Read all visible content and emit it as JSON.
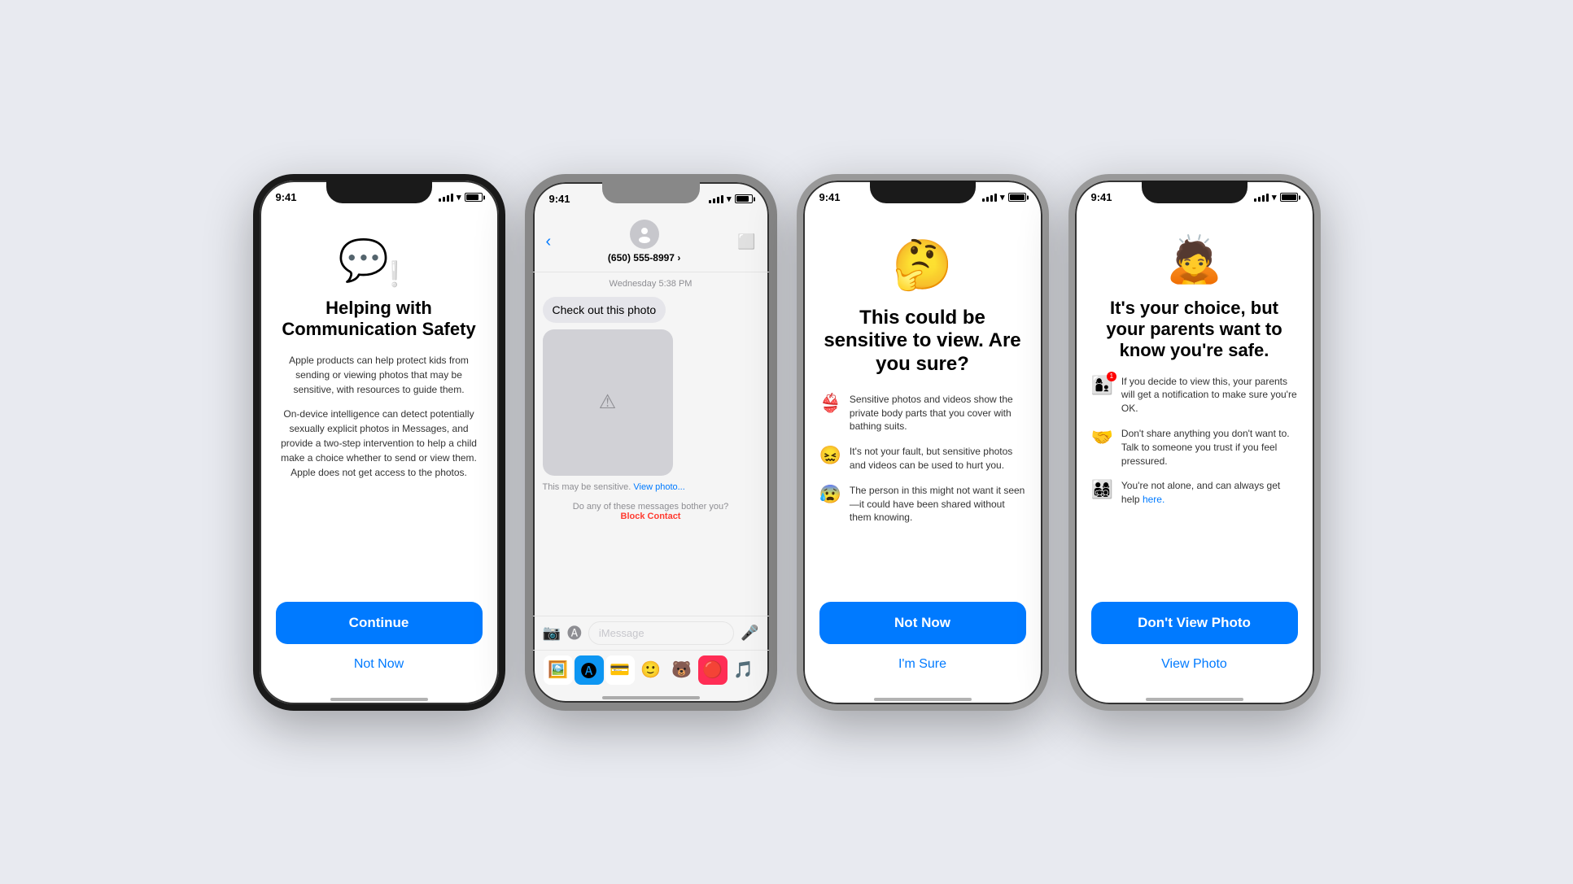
{
  "phone1": {
    "time": "9:41",
    "icon": "💬❕",
    "title": "Helping with Communication Safety",
    "body1": "Apple products can help protect kids from sending or viewing photos that may be sensitive, with resources to guide them.",
    "body2": "On-device intelligence can detect potentially sexually explicit photos in Messages, and provide a two-step intervention to help a child make a choice whether to send or view them. Apple does not get access to the photos.",
    "btn_primary": "Continue",
    "btn_link": "Not Now"
  },
  "phone2": {
    "time": "9:41",
    "phone_number": "(650) 555-8997 ›",
    "date_time": "Wednesday 5:38 PM",
    "message": "Check out this photo",
    "sensitive_text": "This may be sensitive.",
    "view_photo": "View photo...",
    "block_text": "Do any of these messages bother you?",
    "block_link": "Block Contact",
    "input_placeholder": "iMessage"
  },
  "phone3": {
    "time": "9:41",
    "emoji": "🤔",
    "title": "This could be sensitive to view. Are you sure?",
    "items": [
      {
        "emoji": "👙",
        "text": "Sensitive photos and videos show the private body parts that you cover with bathing suits."
      },
      {
        "emoji": "😖",
        "text": "It's not your fault, but sensitive photos and videos can be used to hurt you."
      },
      {
        "emoji": "😰",
        "text": "The person in this might not want it seen—it could have been shared without them knowing."
      }
    ],
    "btn_primary": "Not Now",
    "btn_link": "I'm Sure"
  },
  "phone4": {
    "time": "9:41",
    "emoji": "🙇",
    "title": "It's your choice, but your parents want to know you're safe.",
    "items": [
      {
        "emoji": "👩‍👦",
        "text": "If you decide to view this, your parents will get a notification to make sure you're OK."
      },
      {
        "emoji": "🤝",
        "text": "Don't share anything you don't want to. Talk to someone you trust if you feel pressured."
      },
      {
        "emoji": "👨‍👩‍👧‍👦",
        "text": "You're not alone, and can always get help here."
      }
    ],
    "btn_primary": "Don't View Photo",
    "btn_link": "View Photo",
    "here_link": "here."
  }
}
